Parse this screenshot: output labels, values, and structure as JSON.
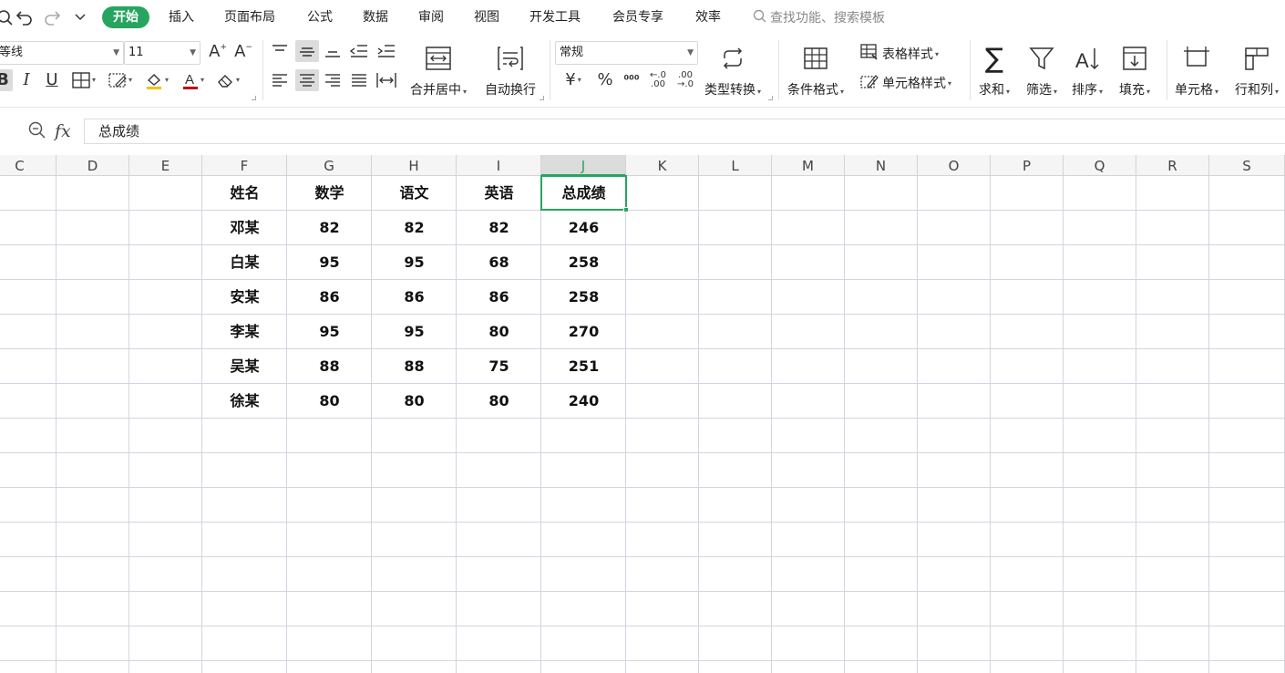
{
  "menubar": {
    "tabs": [
      "开始",
      "插入",
      "页面布局",
      "公式",
      "数据",
      "审阅",
      "视图",
      "开发工具",
      "会员专享",
      "效率"
    ],
    "search_placeholder": "查找功能、搜索模板"
  },
  "ribbon": {
    "font_name": "等线",
    "font_size": "11",
    "number_format": "常规",
    "merge_center": "合并居中",
    "wrap_text": "自动换行",
    "type_convert": "类型转换",
    "conditional_format": "条件格式",
    "table_style": "表格样式",
    "cell_style": "单元格样式",
    "sum": "求和",
    "filter": "筛选",
    "sort": "排序",
    "fill": "填充",
    "cell": "单元格",
    "row_col": "行和列",
    "decimal_increase": "←.0\n.00",
    "decimal_decrease": ".00\n→.0"
  },
  "formula_bar": {
    "fx_label": "fx",
    "value": "总成绩"
  },
  "sheet": {
    "columns": [
      "C",
      "D",
      "E",
      "F",
      "G",
      "H",
      "I",
      "J",
      "K",
      "L",
      "M",
      "N",
      "O",
      "P",
      "Q",
      "R",
      "S"
    ],
    "active_column": "J",
    "headers": [
      "姓名",
      "数学",
      "语文",
      "英语",
      "总成绩"
    ],
    "rows": [
      [
        "邓某",
        "82",
        "82",
        "82",
        "246"
      ],
      [
        "白某",
        "95",
        "95",
        "68",
        "258"
      ],
      [
        "安某",
        "86",
        "86",
        "86",
        "258"
      ],
      [
        "李某",
        "95",
        "95",
        "80",
        "270"
      ],
      [
        "吴某",
        "88",
        "88",
        "75",
        "251"
      ],
      [
        "徐某",
        "80",
        "80",
        "80",
        "240"
      ]
    ]
  },
  "colors": {
    "accent": "#27a560",
    "font_color_bar": "#c00000",
    "highlight_bar": "#f2c200"
  }
}
